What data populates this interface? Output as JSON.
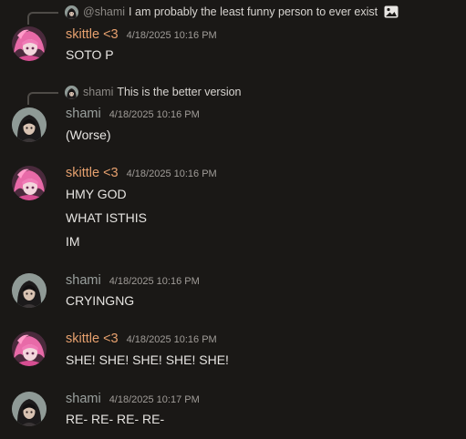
{
  "messages": [
    {
      "reply": {
        "author": "@shami",
        "text": "I am probably the least funny person to ever exist",
        "has_image_icon": true
      },
      "author": "skittle <3",
      "timestamp": "4/18/2025 10:16 PM",
      "lines": [
        "SOTO P"
      ]
    },
    {
      "reply": {
        "author": "shami",
        "text": "This is the better version",
        "has_image_icon": false
      },
      "author": "shami",
      "timestamp": "4/18/2025 10:16 PM",
      "lines": [
        "(Worse)"
      ]
    },
    {
      "author": "skittle <3",
      "timestamp": "4/18/2025 10:16 PM",
      "lines": [
        "HMY GOD",
        "WHAT ISTHIS",
        "IM"
      ]
    },
    {
      "author": "shami",
      "timestamp": "4/18/2025 10:16 PM",
      "lines": [
        "CRYINGNG"
      ]
    },
    {
      "author": "skittle <3",
      "timestamp": "4/18/2025 10:16 PM",
      "lines": [
        "SHE! SHE! SHE! SHE! SHE!"
      ]
    },
    {
      "author": "shami",
      "timestamp": "4/18/2025 10:17 PM",
      "lines": [
        "RE- RE- RE- RE-"
      ]
    }
  ],
  "colors": {
    "background": "#1a1816",
    "skittle_name": "#e6a06e",
    "shami_name": "#9aa09e"
  },
  "icons": {
    "skittle_avatar": "pink-haired-anime-avatar-icon",
    "shami_avatar": "dark-haired-anime-avatar-icon",
    "attachment": "image-icon"
  }
}
